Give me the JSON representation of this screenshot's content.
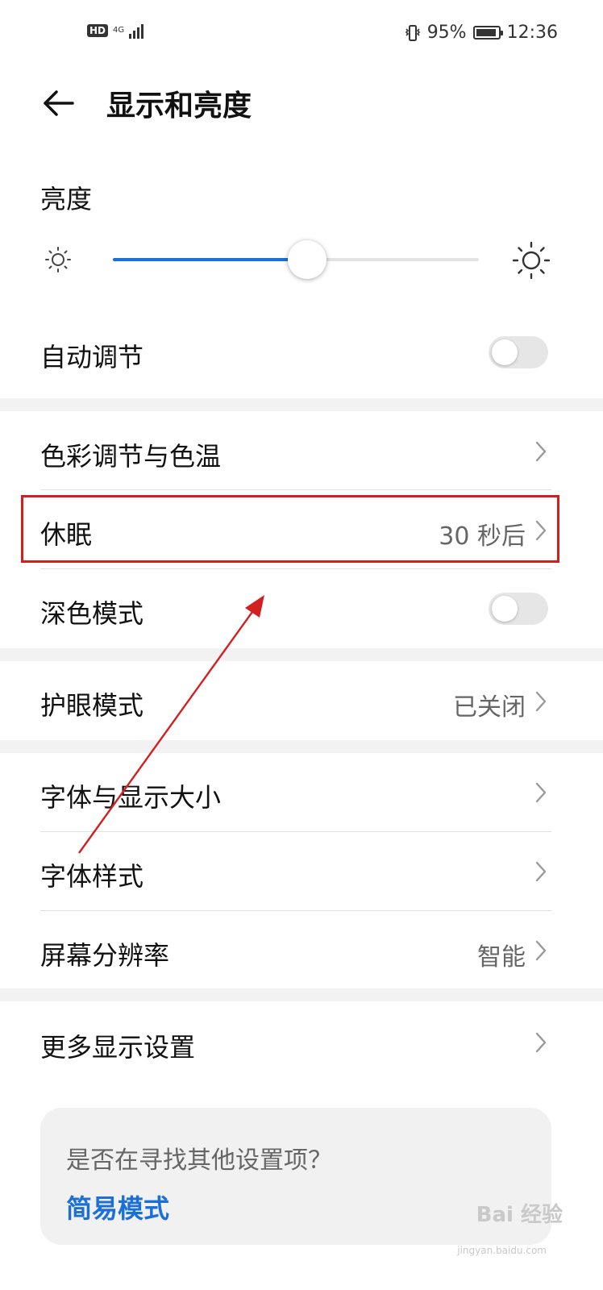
{
  "status_bar": {
    "hd": "HD",
    "network": "4G",
    "battery_text": "95%",
    "battery_level": 0.95,
    "time": "12:36"
  },
  "header": {
    "title": "显示和亮度"
  },
  "brightness": {
    "label": "亮度",
    "level_percent": 53
  },
  "rows": {
    "auto_adjust": {
      "label": "自动调节",
      "on": false
    },
    "color_temp": {
      "label": "色彩调节与色温"
    },
    "sleep": {
      "label": "休眠",
      "value": "30 秒后"
    },
    "dark_mode": {
      "label": "深色模式",
      "on": false
    },
    "eye_care": {
      "label": "护眼模式",
      "value": "已关闭"
    },
    "font_size": {
      "label": "字体与显示大小"
    },
    "font_style": {
      "label": "字体样式"
    },
    "resolution": {
      "label": "屏幕分辨率",
      "value": "智能"
    },
    "more_display": {
      "label": "更多显示设置"
    }
  },
  "suggestion_card": {
    "question": "是否在寻找其他设置项？",
    "link": "简易模式"
  },
  "watermark": {
    "text": "Bai 经验",
    "sub": "jingyan.baidu.com"
  },
  "colors": {
    "accent": "#1a6fd8",
    "annotation": "#d22020"
  }
}
